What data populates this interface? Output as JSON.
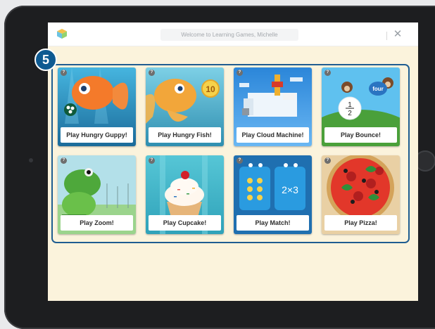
{
  "header": {
    "title": "Welcome to Learning Games, Michelle",
    "close_glyph": "✕",
    "logo_icon": "cube-icon"
  },
  "step": {
    "number": "5"
  },
  "help_glyph": "?",
  "games": [
    {
      "label": "Play Hungry Guppy!",
      "icon": "guppy-fish",
      "colors": [
        "#46b5df",
        "#1b6b9a"
      ]
    },
    {
      "label": "Play Hungry Fish!",
      "icon": "goldfish",
      "badge": "10",
      "colors": [
        "#7dd0e6",
        "#2f8fb0"
      ]
    },
    {
      "label": "Play Cloud Machine!",
      "icon": "cloud-machine",
      "colors": [
        "#2b86d9",
        "#6ab7f3"
      ]
    },
    {
      "label": "Play Bounce!",
      "icon": "monkeys-balloons",
      "badge": "four",
      "fraction_num": "1",
      "fraction_den": "2",
      "colors": [
        "#5fc1ef",
        "#4aa03a"
      ]
    },
    {
      "label": "Play Zoom!",
      "icon": "frog",
      "colors": [
        "#b3e0e9",
        "#9bd48c"
      ]
    },
    {
      "label": "Play Cupcake!",
      "icon": "cupcake",
      "colors": [
        "#56c6d6",
        "#2fa2b9"
      ]
    },
    {
      "label": "Play Match!",
      "icon": "match-cards",
      "badge": "2×3",
      "colors": [
        "#1f6fb0",
        "#2a9be0"
      ]
    },
    {
      "label": "Play Pizza!",
      "icon": "pizza",
      "colors": [
        "#e9d0a4",
        "#d4a35a"
      ]
    }
  ]
}
